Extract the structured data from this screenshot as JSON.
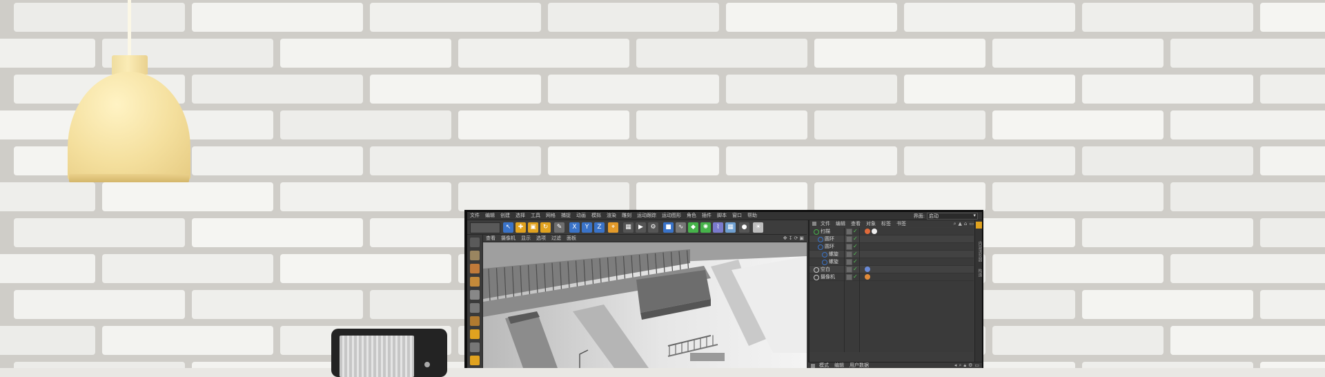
{
  "app": {
    "menu": [
      "文件",
      "编辑",
      "创建",
      "选择",
      "工具",
      "网格",
      "捕捉",
      "动画",
      "模拟",
      "渲染",
      "雕刻",
      "运动跟踪",
      "运动图形",
      "角色",
      "插件",
      "脚本",
      "窗口",
      "帮助"
    ],
    "layout_label": "界面:",
    "layout_value": "启动"
  },
  "toolbar": {
    "icons": [
      "live-selection-icon",
      "move-icon",
      "scale-icon",
      "rotate-icon",
      "last-tool-icon",
      "x-axis-icon",
      "y-axis-icon",
      "z-axis-icon",
      "coordinate-system-icon",
      "render-view-icon",
      "render-to-picture-viewer-icon",
      "render-settings-icon",
      "cube-icon",
      "pen-spline-icon",
      "subdivision-surface-icon",
      "array-icon",
      "deformer-icon",
      "floor-icon",
      "camera-icon",
      "light-icon"
    ],
    "colors": {
      "blue": "#3a73c8",
      "orange": "#e39a2a",
      "accent": "#e0a21f",
      "green": "#46b34a"
    }
  },
  "viewport": {
    "menu": [
      "查看",
      "摄像机",
      "显示",
      "选项",
      "过滤",
      "面板"
    ]
  },
  "object_manager": {
    "tabs": [
      "文件",
      "编辑",
      "查看",
      "对象",
      "标签",
      "书签"
    ],
    "side_tabs": [
      "内容浏览器",
      "构造"
    ],
    "objects": [
      {
        "name": "扫描",
        "icon": "sweep-icon",
        "indent": 0
      },
      {
        "name": "圆环",
        "icon": "circle-icon",
        "indent": 1
      },
      {
        "name": "圆环",
        "icon": "circle-icon",
        "indent": 1
      },
      {
        "name": "螺旋",
        "icon": "helix-icon",
        "indent": 2
      },
      {
        "name": "螺旋",
        "icon": "helix-icon",
        "indent": 2
      },
      {
        "name": "空白",
        "icon": "null-icon",
        "indent": 0
      },
      {
        "name": "摄像机",
        "icon": "camera-icon",
        "indent": 0
      }
    ]
  },
  "attributes": {
    "menu": [
      "模式",
      "编辑",
      "用户数据"
    ]
  }
}
